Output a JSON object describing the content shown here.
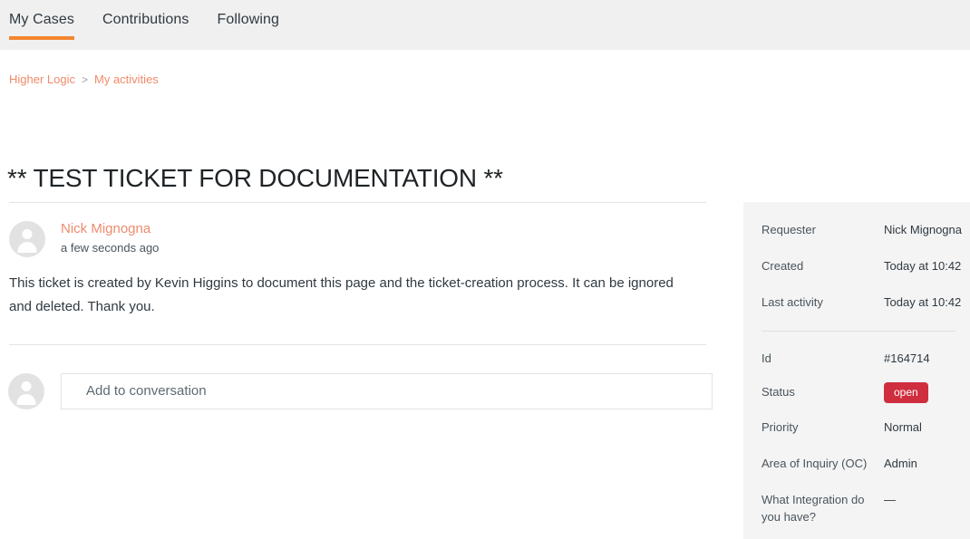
{
  "theme": {
    "accent_orange": "#f2862f",
    "link_coral": "#f08a6a",
    "status_red": "#cf2e3f",
    "header_bg": "#f0f0f0",
    "sidebar_bg": "#f4f4f4"
  },
  "tabs": [
    {
      "label": "My Cases",
      "active": true
    },
    {
      "label": "Contributions",
      "active": false
    },
    {
      "label": "Following",
      "active": false
    }
  ],
  "breadcrumb": {
    "items": [
      {
        "label": "Higher Logic"
      },
      {
        "label": "My activities"
      }
    ],
    "separator": ">"
  },
  "page": {
    "title": "** TEST TICKET FOR DOCUMENTATION **"
  },
  "comment": {
    "author": "Nick Mignogna",
    "timestamp": "a few seconds ago",
    "body": "This ticket is created by Kevin Higgins to document this page and the ticket-creation process. It can be ignored and deleted. Thank you."
  },
  "reply": {
    "placeholder": "Add to conversation",
    "value": ""
  },
  "sidebar": {
    "group_one": [
      {
        "label": "Requester",
        "value": "Nick Mignogna"
      },
      {
        "label": "Created",
        "value": "Today at 10:42"
      },
      {
        "label": "Last activity",
        "value": "Today at 10:42"
      }
    ],
    "id": {
      "label": "Id",
      "value": "#164714"
    },
    "status": {
      "label": "Status",
      "value": "open"
    },
    "group_two": [
      {
        "label": "Priority",
        "value": "Normal"
      },
      {
        "label": "Area of Inquiry (OC)",
        "value": "Admin"
      },
      {
        "label": "What Integration do you have?",
        "value": "—"
      }
    ]
  }
}
